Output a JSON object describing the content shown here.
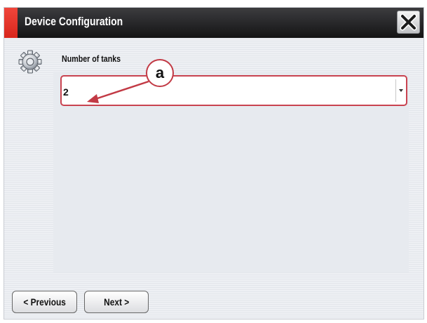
{
  "window": {
    "title": "Device Configuration",
    "accent_color": "#e2342a",
    "close_icon": "close-x-icon"
  },
  "settings": {
    "icon": "gear-icon",
    "field_label": "Number of tanks",
    "selected_value": "2"
  },
  "callout": {
    "letter": "a",
    "color": "#c23a45"
  },
  "footer": {
    "previous_label": "< Previous",
    "next_label": "Next >"
  }
}
